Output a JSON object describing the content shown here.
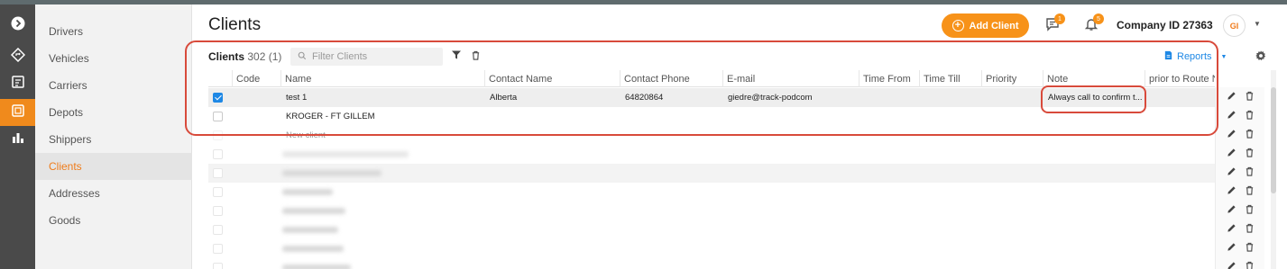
{
  "header": {
    "title": "Clients",
    "add_button": "Add Client",
    "messages_badge": "1",
    "notifications_badge": "5",
    "company": "Company ID 27363",
    "avatar_initials": "GI"
  },
  "sidebar": {
    "items": [
      {
        "label": "Drivers",
        "active": false
      },
      {
        "label": "Vehicles",
        "active": false
      },
      {
        "label": "Carriers",
        "active": false
      },
      {
        "label": "Depots",
        "active": false
      },
      {
        "label": "Shippers",
        "active": false
      },
      {
        "label": "Clients",
        "active": true
      },
      {
        "label": "Addresses",
        "active": false
      },
      {
        "label": "Goods",
        "active": false
      }
    ]
  },
  "rail": {
    "icons": [
      "chevron-right-icon",
      "route-icon",
      "board-icon",
      "depot-icon",
      "bar-chart-icon"
    ]
  },
  "toolbar": {
    "title": "Clients",
    "count": "302 (1)",
    "filter_placeholder": "Filter Clients",
    "reports_label": "Reports"
  },
  "table": {
    "columns": [
      "Code",
      "Name",
      "Contact Name",
      "Contact Phone",
      "E-mail",
      "Time From",
      "Time Till",
      "Priority",
      "Note",
      "prior to Route N"
    ],
    "rows": [
      {
        "checked": true,
        "code": "",
        "name": "test 1",
        "contact_name": "Alberta",
        "contact_phone": "64820864",
        "email": "giedre@track-podcom",
        "time_from": "",
        "time_till": "",
        "priority": "",
        "note": "Always call to confirm t..."
      },
      {
        "checked": false,
        "code": "",
        "name": "KROGER - FT GILLEM",
        "contact_name": "",
        "contact_phone": "",
        "email": "",
        "time_from": "",
        "time_till": "",
        "priority": "",
        "note": ""
      },
      {
        "checked": false,
        "code": "",
        "name": "New client",
        "contact_name": "",
        "contact_phone": "",
        "email": "",
        "time_from": "",
        "time_till": "",
        "priority": "",
        "note": ""
      }
    ]
  },
  "colors": {
    "accent": "#f79219",
    "active_nav": "#ef7c1a",
    "link_blue": "#1e88e5",
    "highlight": "#d84a3b"
  }
}
